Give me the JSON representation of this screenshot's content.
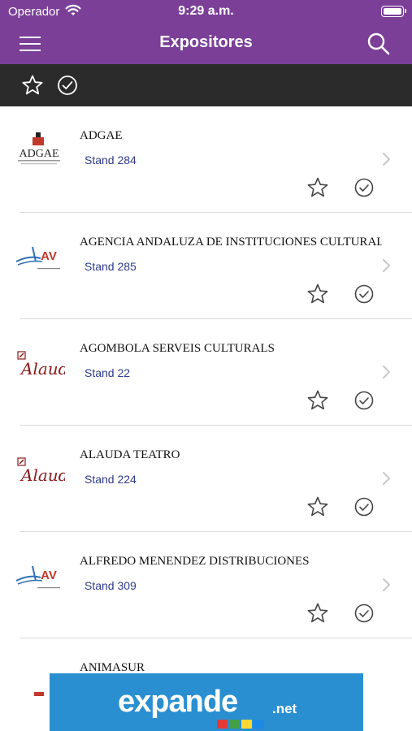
{
  "status_bar": {
    "carrier": "Operador",
    "time": "9:29 a.m."
  },
  "nav": {
    "title": "Expositores",
    "menu_icon": "hamburger-menu-icon",
    "search_icon": "search-icon"
  },
  "filter_bar": {
    "favorites_icon": "star-outline-icon",
    "visited_icon": "check-circle-icon"
  },
  "exhibitors": [
    {
      "name": "ADGAE",
      "stand": "Stand 284",
      "logo": "adgae-logo"
    },
    {
      "name": "AGENCIA ANDALUZA DE INSTITUCIONES CULTURALES",
      "stand": "Stand 285",
      "logo": "aaiicc-logo"
    },
    {
      "name": "AGOMBOLA SERVEIS CULTURALS",
      "stand": "Stand 22",
      "logo": "alauda-logo"
    },
    {
      "name": "ALAUDA TEATRO",
      "stand": "Stand 224",
      "logo": "alauda-logo"
    },
    {
      "name": "ALFREDO MENENDEZ DISTRIBUCIONES",
      "stand": "Stand 309",
      "logo": "aaiicc-logo"
    },
    {
      "name": "ANIMASUR",
      "stand": "",
      "logo": "animasur-logo"
    }
  ],
  "ad": {
    "brand": "expande",
    "suffix": ".net"
  },
  "colors": {
    "nav_purple": "#7b3f98",
    "filter_bar": "#2b2b2b",
    "stand_text": "#2e3a8c",
    "ad_blue": "#2a8fd0"
  }
}
